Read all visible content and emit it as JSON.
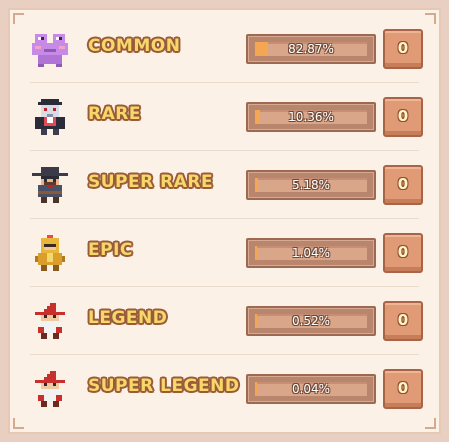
{
  "rarities": [
    {
      "label": "COMMON",
      "percent_text": "82.87%",
      "percent_value": 82.87,
      "count": "0",
      "character_icon": "frog-icon"
    },
    {
      "label": "RARE",
      "percent_text": "10.36%",
      "percent_value": 10.36,
      "count": "0",
      "character_icon": "vampire-icon"
    },
    {
      "label": "SUPER RARE",
      "percent_text": "5.18%",
      "percent_value": 5.18,
      "count": "0",
      "character_icon": "cowboy-icon"
    },
    {
      "label": "EPIC",
      "percent_text": "1.04%",
      "percent_value": 1.04,
      "count": "0",
      "character_icon": "knight-icon"
    },
    {
      "label": "LEGEND",
      "percent_text": "0.52%",
      "percent_value": 0.52,
      "count": "0",
      "character_icon": "red-wizard-icon"
    },
    {
      "label": "SUPER LEGEND",
      "percent_text": "0.04%",
      "percent_value": 0.04,
      "count": "0",
      "character_icon": "red-wizard-icon"
    }
  ],
  "colors": {
    "panel_bg": "#fbf1e6",
    "label_fill": "#f6d86a",
    "label_outline": "#9a5b3a",
    "bar_fill": "#f5a653",
    "count_button": "#e09b76"
  }
}
